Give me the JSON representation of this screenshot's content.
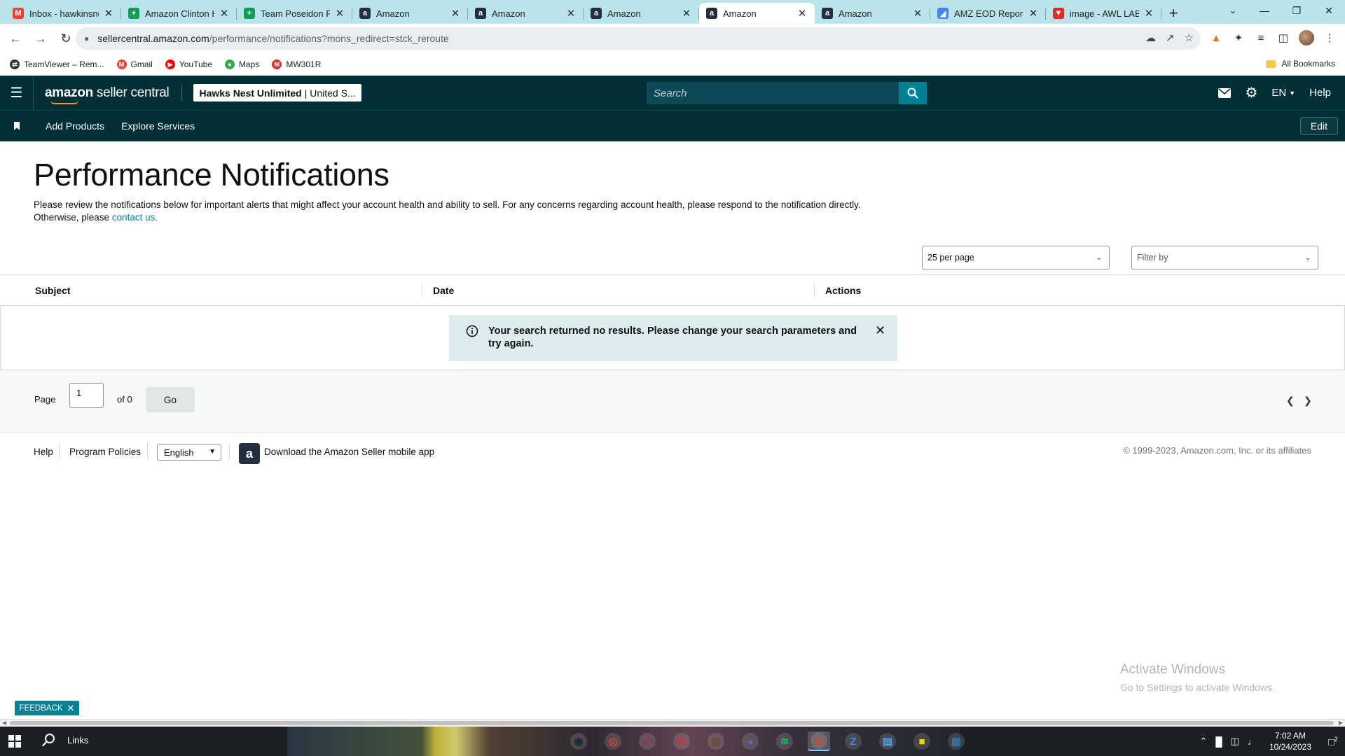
{
  "browser": {
    "tabs": [
      {
        "title": "Inbox - hawkinsne",
        "icon": "gmail-icon",
        "color": "#ea4335",
        "glyph": "M",
        "active": false
      },
      {
        "title": "Amazon Clinton H",
        "icon": "sheets-icon",
        "color": "#0f9d58",
        "glyph": "+",
        "active": false
      },
      {
        "title": "Team Poseidon PF",
        "icon": "sheets-icon",
        "color": "#0f9d58",
        "glyph": "+",
        "active": false
      },
      {
        "title": "Amazon",
        "icon": "amazon-icon",
        "color": "#232f3e",
        "glyph": "a",
        "active": false
      },
      {
        "title": "Amazon",
        "icon": "amazon-icon",
        "color": "#232f3e",
        "glyph": "a",
        "active": false
      },
      {
        "title": "Amazon",
        "icon": "amazon-icon",
        "color": "#232f3e",
        "glyph": "a",
        "active": false
      },
      {
        "title": "Amazon",
        "icon": "amazon-icon",
        "color": "#232f3e",
        "glyph": "a",
        "active": true
      },
      {
        "title": "Amazon",
        "icon": "amazon-icon",
        "color": "#232f3e",
        "glyph": "a",
        "active": false
      },
      {
        "title": "AMZ EOD Report",
        "icon": "report-icon",
        "color": "#4285f4",
        "glyph": "◢",
        "active": false
      },
      {
        "title": "image - AWL LAB",
        "icon": "image-icon",
        "color": "#d93025",
        "glyph": "▼",
        "active": false
      }
    ],
    "url_host": "sellercentral.amazon.com",
    "url_path": "/performance/notifications?mons_redirect=stck_reroute",
    "bookmarks": [
      {
        "label": "TeamViewer – Rem...",
        "icon": "teamviewer-icon",
        "color": "#333333",
        "glyph": "⇄"
      },
      {
        "label": "Gmail",
        "icon": "gmail-icon",
        "color": "#ea4335",
        "glyph": "M"
      },
      {
        "label": "YouTube",
        "icon": "youtube-icon",
        "color": "#ff0000",
        "glyph": "▶"
      },
      {
        "label": "Maps",
        "icon": "maps-icon",
        "color": "#34a853",
        "glyph": "●"
      },
      {
        "label": "MW301R",
        "icon": "mw-icon",
        "color": "#d32f2f",
        "glyph": "M"
      }
    ],
    "all_bookmarks": "All Bookmarks"
  },
  "header": {
    "logo_text": "amazon",
    "logo_suffix": " seller central",
    "store_name": "Hawks Nest Unlimited",
    "store_region": "| United S...",
    "search_placeholder": "Search",
    "language": "EN",
    "help": "Help"
  },
  "subnav": {
    "links": [
      "Add Products",
      "Explore Services"
    ],
    "edit": "Edit"
  },
  "page": {
    "title": "Performance Notifications",
    "description": "Please review the notifications below for important alerts that might affect your account health and ability to sell. For any concerns regarding account health, please respond to the notification directly. Otherwise, please ",
    "contact_link": "contact us.",
    "per_page": "25 per page",
    "filter_placeholder": "Filter by",
    "columns": [
      "Subject",
      "Date",
      "Actions"
    ],
    "alert_message": "Your search returned no results. Please change your search parameters and try again.",
    "pager": {
      "page_label": "Page",
      "current_page": "1",
      "of_label": "of 0",
      "go": "Go"
    }
  },
  "footer": {
    "help": "Help",
    "program_policies": "Program Policies",
    "language": "English",
    "app_promo": "Download the Amazon Seller mobile app",
    "copyright": "© 1999-2023, Amazon.com, Inc. or its affiliates"
  },
  "overlay": {
    "watermark_title": "Activate Windows",
    "watermark_sub": "Go to Settings to activate Windows.",
    "feedback": "FEEDBACK"
  },
  "taskbar": {
    "search_label": "Links",
    "apps": [
      {
        "name": "steam-icon",
        "color": "#1b2838",
        "glyph": "◉",
        "active": false
      },
      {
        "name": "chrome-icon",
        "color": "#db4437",
        "glyph": "◎",
        "active": false
      },
      {
        "name": "app-icon",
        "color": "#c2185b",
        "glyph": "✓",
        "active": false
      },
      {
        "name": "opera-icon",
        "color": "#ff1b2d",
        "glyph": "O",
        "active": false
      },
      {
        "name": "photo-icon",
        "color": "#6d4c41",
        "glyph": "▦",
        "active": false
      },
      {
        "name": "discord-icon",
        "color": "#5865f2",
        "glyph": "◕",
        "active": false
      },
      {
        "name": "spotify-icon",
        "color": "#1db954",
        "glyph": "≋",
        "active": false
      },
      {
        "name": "chrome-profile-icon",
        "color": "#db4437",
        "glyph": "◎",
        "active": true
      },
      {
        "name": "zoom-icon",
        "color": "#2d8cff",
        "glyph": "Z",
        "active": false
      },
      {
        "name": "notepad-icon",
        "color": "#4aa3df",
        "glyph": "▤",
        "active": false
      },
      {
        "name": "sticky-notes-icon",
        "color": "#f7d000",
        "glyph": "■",
        "active": false
      },
      {
        "name": "calculator-icon",
        "color": "#3a6ea5",
        "glyph": "▦",
        "active": false
      }
    ],
    "time": "7:02 AM",
    "date": "10/24/2023",
    "notifications": "2"
  }
}
